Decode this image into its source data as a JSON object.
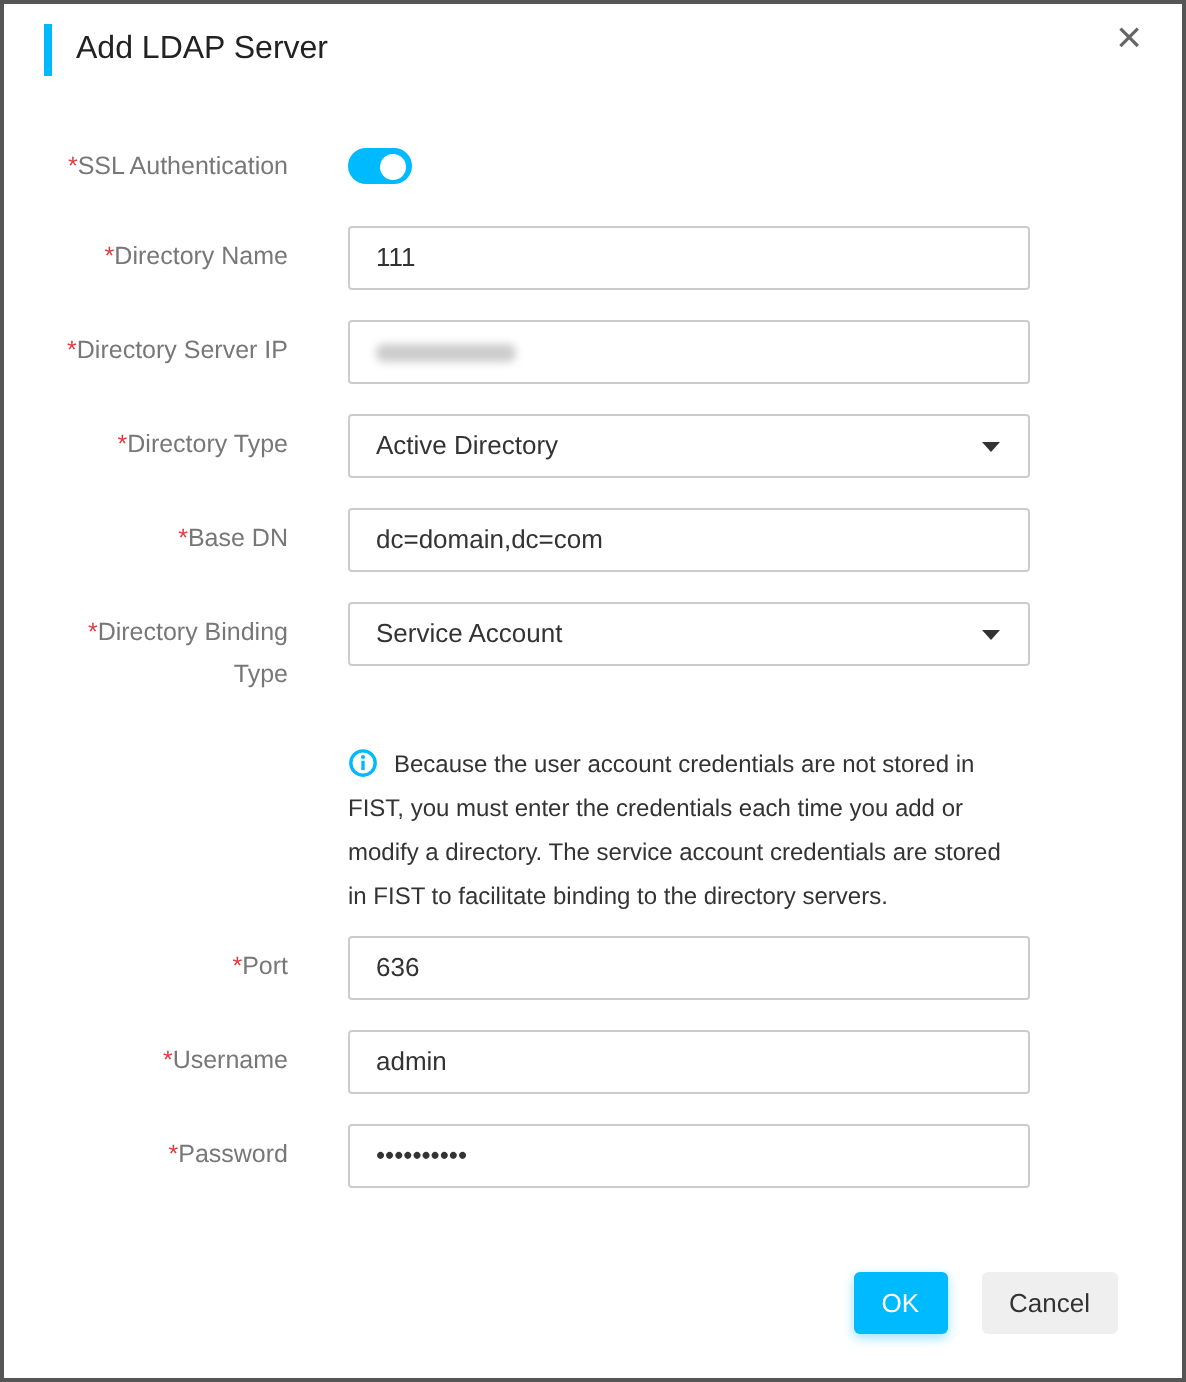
{
  "dialog": {
    "title": "Add LDAP Server",
    "close": "×"
  },
  "fields": [
    {
      "kind": "toggle",
      "required_mark": "*",
      "label": "SSL Authentication",
      "on": true
    },
    {
      "kind": "text",
      "required_mark": "*",
      "label": "Directory Name",
      "value": "111"
    },
    {
      "kind": "text",
      "required_mark": "*",
      "label": "Directory Server IP",
      "redacted": true
    },
    {
      "kind": "select",
      "required_mark": "*",
      "label": "Directory Type",
      "value": "Active Directory"
    },
    {
      "kind": "text",
      "required_mark": "*",
      "label": "Base DN",
      "value": "dc=domain,dc=com"
    },
    {
      "kind": "select",
      "required_mark": "*",
      "label": "Directory Binding Type",
      "value": "Service Account"
    },
    {
      "kind": "note",
      "text": "Because the user account credentials are not stored in FIST, you must enter the credentials each time you add or modify a directory. The service account credentials are stored in FIST to facilitate binding to the directory servers."
    },
    {
      "kind": "text",
      "required_mark": "*",
      "label": "Port",
      "value": "636"
    },
    {
      "kind": "text",
      "required_mark": "*",
      "label": "Username",
      "value": "admin"
    },
    {
      "kind": "text",
      "required_mark": "*",
      "label": "Password",
      "value": "••••••••••"
    }
  ],
  "buttons": [
    {
      "label": "OK",
      "kind": "primary"
    },
    {
      "label": "Cancel",
      "kind": "secondary"
    }
  ]
}
